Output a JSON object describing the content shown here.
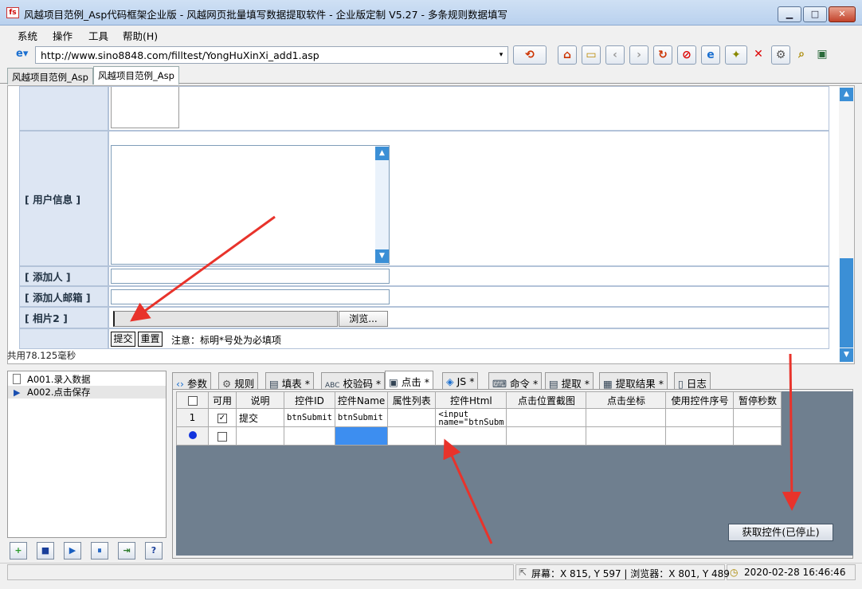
{
  "window": {
    "title": "风越项目范例_Asp代码框架企业版 - 风越网页批量填写数据提取软件 - 企业版定制 V5.27 - 多条规则数据填写",
    "minimize": "▁",
    "maximize": "□",
    "close": "✕"
  },
  "menu": [
    "系统",
    "操作",
    "工具",
    "帮助(H)"
  ],
  "address": {
    "url": "http://www.sino8848.com/filltest/YongHuXinXi_add1.asp",
    "dropdown": "▾"
  },
  "toolbar": {
    "icons": [
      "person-refresh-icon",
      "home-icon",
      "folder-icon",
      "back-icon",
      "forward-icon",
      "refresh-icon",
      "stop-icon",
      "ie-icon",
      "magic-icon",
      "close-red-icon",
      "gear-icon",
      "search-icon",
      "window-icon"
    ],
    "glyphs": [
      "⟲",
      "⌂",
      "▭",
      "‹",
      "›",
      "↻",
      "⊘",
      "e",
      "✦",
      "✕",
      "⚙",
      "⌕",
      "▣"
    ]
  },
  "tabs_top": [
    "风越项目范例_Asp",
    "风越项目范例_Asp"
  ],
  "form": {
    "user_info_label": "[ 用户信息 ]",
    "adder_label": "[ 添加人 ]",
    "adder_email_label": "[ 添加人邮箱 ]",
    "photo2_label": "[ 相片2 ]",
    "browse_button": "浏览...",
    "submit_button": "提交",
    "reset_button": "重置",
    "note": "注意：标明*号处为必填项"
  },
  "load_time": "共用78.125毫秒",
  "steps": [
    {
      "label": "A001.录入数据"
    },
    {
      "label": "A002.点击保存"
    }
  ],
  "bottom_buttons": [
    "+",
    "■",
    "▶",
    "⏸",
    "⇥",
    "?"
  ],
  "right_tabs": [
    {
      "label": "参数",
      "icon": "code-icon"
    },
    {
      "label": "规则",
      "icon": "gear-icon"
    },
    {
      "label": "填表 *",
      "icon": "table-icon"
    },
    {
      "label": "校验码 *",
      "icon": "abc-icon"
    },
    {
      "label": "点击 *",
      "icon": "click-icon"
    },
    {
      "label": "JS *",
      "icon": "js-icon"
    },
    {
      "label": "命令 *",
      "icon": "keyboard-icon"
    },
    {
      "label": "提取 *",
      "icon": "extract-icon"
    },
    {
      "label": "提取结果 *",
      "icon": "result-icon"
    },
    {
      "label": "日志",
      "icon": "log-icon"
    }
  ],
  "grid": {
    "headers": [
      "",
      "可用",
      "说明",
      "控件ID",
      "控件Name",
      "属性列表",
      "控件Html",
      "点击位置截图",
      "点击坐标",
      "使用控件序号",
      "暂停秒数"
    ],
    "row1": {
      "num": "1",
      "enabled": "✓",
      "desc": "提交",
      "id": "btnSubmit",
      "name": "btnSubmit",
      "attrs": "",
      "html": "<input name=\"btnSubm",
      "shot": "",
      "coord": "",
      "index": "",
      "pause": ""
    }
  },
  "get_control_button": "获取控件(已停止)",
  "status": {
    "screen": "屏幕：X 815, Y 597 | 浏览器：X 801, Y 489",
    "datetime": "2020-02-28 16:46:46"
  },
  "colors": {
    "arrow": "#e8332b",
    "label_bg": "#dde6f3",
    "label_text": "#234",
    "grid_bg": "#6f7f8f",
    "highlight": "#3d8ef0"
  }
}
